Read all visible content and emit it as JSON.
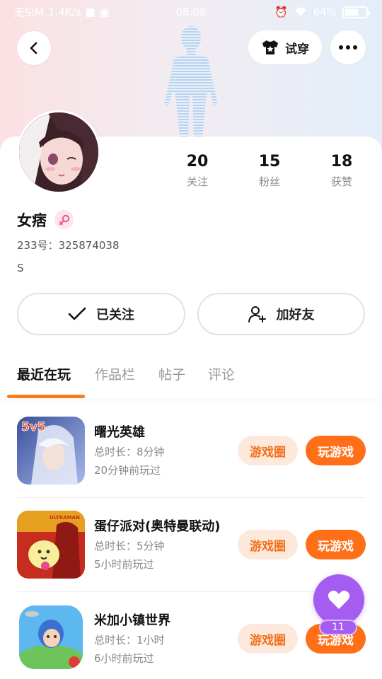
{
  "status_bar": {
    "carrier": "无SIM",
    "speed": "1.4K/s",
    "time": "08:08",
    "battery": "64%",
    "battery_level": 0.64
  },
  "top_bar": {
    "back_icon": "back-arrow-icon",
    "tryon_label": "试穿",
    "more_icon": "more-dots-icon"
  },
  "profile": {
    "stats": [
      {
        "value": "20",
        "label": "关注"
      },
      {
        "value": "15",
        "label": "粉丝"
      },
      {
        "value": "18",
        "label": "获赞"
      }
    ],
    "username": "女痞",
    "gender_icon": "female-icon",
    "uid": "233号：325874038",
    "bio": "S",
    "followed_label": "已关注",
    "add_friend_label": "加好友"
  },
  "tabs": [
    {
      "label": "最近在玩",
      "active": true
    },
    {
      "label": "作品栏",
      "active": false
    },
    {
      "label": "帖子",
      "active": false
    },
    {
      "label": "评论",
      "active": false
    }
  ],
  "games": [
    {
      "name": "曙光英雄",
      "duration": "总时长：8分钟",
      "last_played": "20分钟前玩过",
      "circle_label": "游戏圈",
      "play_label": "玩游戏",
      "badge": "5v5"
    },
    {
      "name": "蛋仔派对(奥特曼联动)",
      "duration": "总时长：5分钟",
      "last_played": "5小时前玩过",
      "circle_label": "游戏圈",
      "play_label": "玩游戏",
      "badge": "ULTRAMAN"
    },
    {
      "name": "米加小镇世界",
      "duration": "总时长：1小时",
      "last_played": "6小时前玩过",
      "circle_label": "游戏圈",
      "play_label": "玩游戏",
      "badge": ""
    }
  ],
  "like_fab": {
    "icon": "heart-icon",
    "count": "11"
  },
  "colors": {
    "accent": "#ff6f17",
    "accent_light": "#fde9dc",
    "like_purple": "#a55cf0"
  }
}
